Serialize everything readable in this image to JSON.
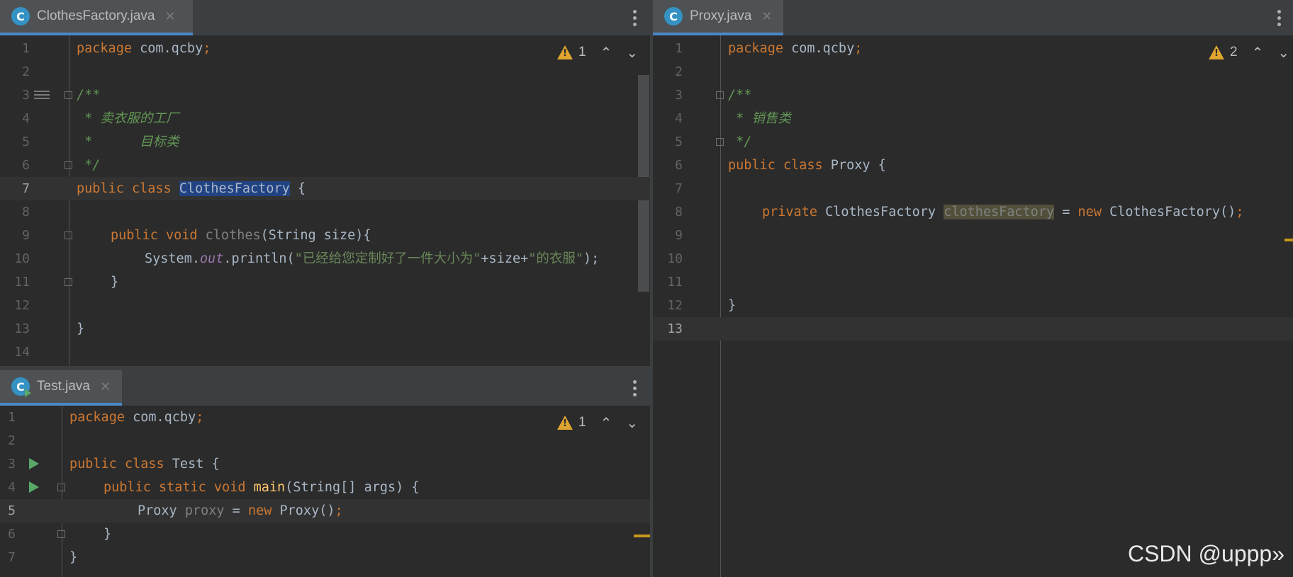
{
  "panes": {
    "clothes": {
      "tab": {
        "icon": "C",
        "title": "ClothesFactory.java",
        "close": "✕"
      },
      "warnings": "1",
      "lines": [
        "1",
        "2",
        "3",
        "4",
        "5",
        "6",
        "7",
        "8",
        "9",
        "10",
        "11",
        "12",
        "13",
        "14"
      ]
    },
    "proxy": {
      "tab": {
        "icon": "C",
        "title": "Proxy.java",
        "close": "✕"
      },
      "warnings": "2",
      "lines": [
        "1",
        "2",
        "3",
        "4",
        "5",
        "6",
        "7",
        "8",
        "9",
        "10",
        "11",
        "12",
        "13"
      ]
    },
    "test": {
      "tab": {
        "icon": "C",
        "title": "Test.java",
        "close": "✕"
      },
      "warnings": "1",
      "lines": [
        "1",
        "2",
        "3",
        "4",
        "5",
        "6",
        "7"
      ]
    }
  },
  "code": {
    "package_kw": "package",
    "package_name": " com.qcby",
    "semi": ";",
    "doc_open": "/**",
    "doc_end": " */",
    "cf_comment1": " * 卖衣服的工厂",
    "cf_comment2": " *      目标类",
    "public": "public",
    "class": " class ",
    "class_cf": "ClothesFactory",
    "brace_open": " {",
    "brace_close": "}",
    "void_kw": " void ",
    "method_clothes": "clothes",
    "clothes_params": "(String size){",
    "system": "System.",
    "out": "out",
    "println_open": ".println(",
    "str1": "\"已经给您定制好了一件大小为\"",
    "plus_size": "+size+",
    "str2": "\"的衣服\"",
    "call_close": ");",
    "proxy_comment": " * 销售类",
    "class_proxy": "Proxy",
    "private_kw": "private",
    "cf_type": " ClothesFactory ",
    "field_name": "clothesFactory",
    "eq": " = ",
    "new_kw": "new",
    "cf_ctor": " ClothesFactory()",
    "class_test": "Test",
    "static_kw": " static",
    "method_main": "main",
    "main_params": "(String[] args) {",
    "proxy_type": "Proxy ",
    "proxy_var": "proxy",
    "proxy_ctor": " Proxy()"
  },
  "arrows": {
    "up": "⌃",
    "down": "⌄"
  },
  "watermark": "CSDN @uppp»"
}
